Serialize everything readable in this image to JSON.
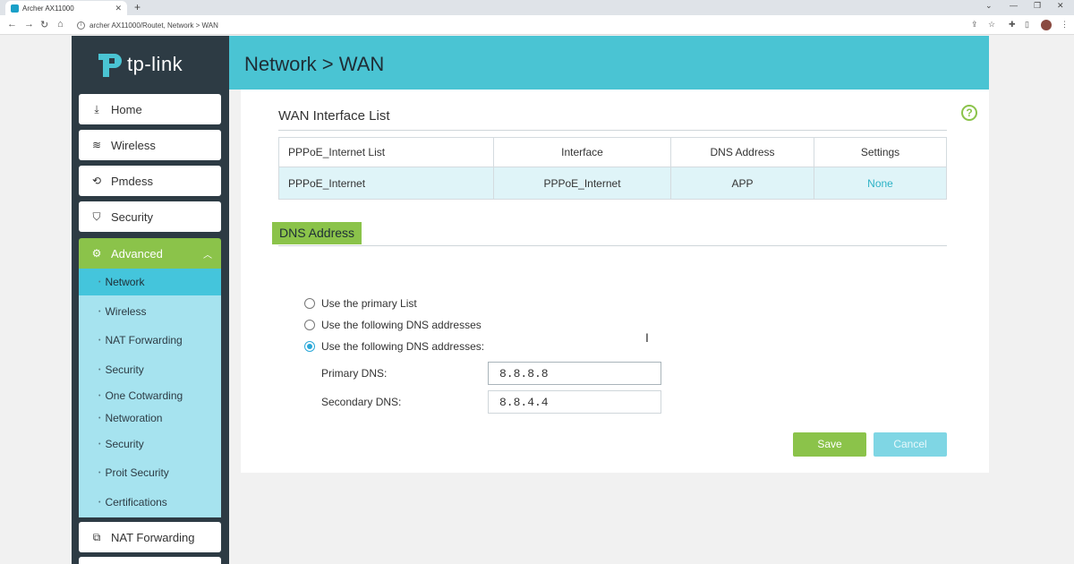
{
  "browser": {
    "tab_title": "Archer AX11000",
    "new_tab": "+",
    "url": "archer AX11000/Routet, Network > WAN"
  },
  "brand": {
    "logo_text": "tp-link"
  },
  "sidebar": {
    "top_items": [
      {
        "label": "Home",
        "icon": "download-icon"
      },
      {
        "label": "Wireless",
        "icon": "wifi-icon"
      },
      {
        "label": "Pmdess",
        "icon": "link-icon"
      },
      {
        "label": "Security",
        "icon": "shield-icon"
      }
    ],
    "advanced": {
      "label": "Advanced",
      "icon": "gear-icon",
      "sub_items": [
        {
          "label": "Network",
          "active": true
        },
        {
          "label": "Wireless"
        },
        {
          "label": "NAT Forwarding"
        },
        {
          "label": "Security"
        },
        {
          "label": "One Cotwarding"
        },
        {
          "label": "Networation"
        },
        {
          "label": "Security"
        },
        {
          "label": "Proit Security"
        },
        {
          "label": "Certifications"
        }
      ]
    },
    "bottom_items": [
      {
        "label": "NAT Forwarding",
        "icon": "forward-icon"
      }
    ]
  },
  "header": {
    "title": "Network > WAN"
  },
  "wan_list": {
    "title": "WAN Interface List",
    "columns": [
      "PPPoE_Internet List",
      "Interface",
      "DNS Address",
      "Settings"
    ],
    "rows": [
      [
        "PPPoE_Internet",
        "PPPoE_Internet",
        "APP",
        "None"
      ]
    ]
  },
  "dns": {
    "title": "DNS Address",
    "options": [
      {
        "label": "Use the primary List",
        "selected": false
      },
      {
        "label": "Use the following DNS addresses",
        "selected": false
      },
      {
        "label": "Use the following DNS addresses:",
        "selected": true
      }
    ],
    "primary_label": "Primary DNS:",
    "primary_value": "8.8.8.8",
    "secondary_label": "Secondary DNS:",
    "secondary_value": "8.8.4.4"
  },
  "buttons": {
    "save": "Save",
    "cancel": "Cancel"
  },
  "colors": {
    "accent_green": "#8bc34a",
    "header_teal": "#4ac4d3",
    "sidebar_dark": "#2d3b44",
    "submenu_light": "#a6e3ef"
  }
}
